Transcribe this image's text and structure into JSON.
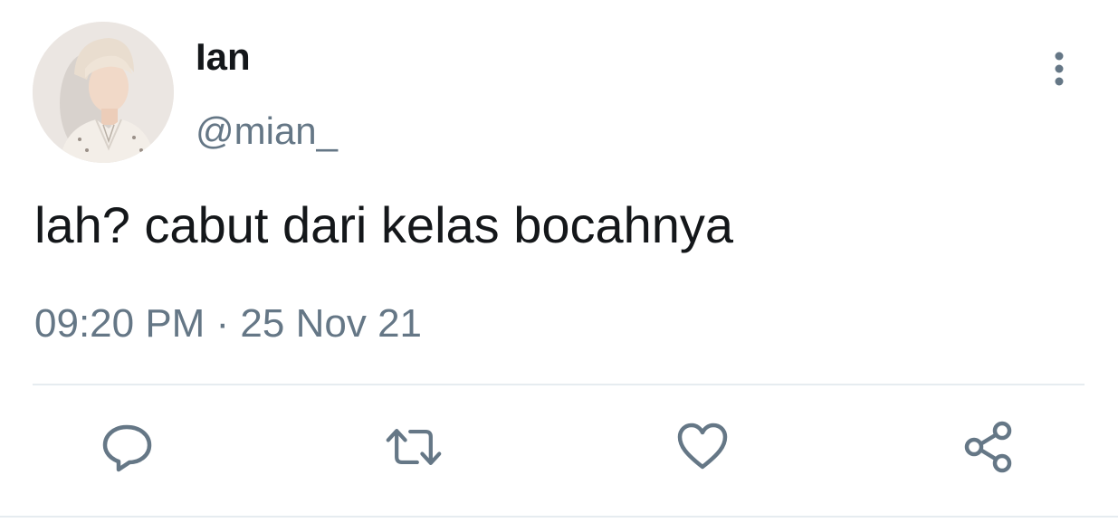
{
  "tweet": {
    "display_name": "Ian",
    "handle": "@mian_",
    "text": "lah? cabut dari kelas bocahnya",
    "timestamp": "09:20 PM · 25 Nov 21"
  },
  "icons": {
    "more": "more-vertical-icon",
    "reply": "reply-icon",
    "retweet": "retweet-icon",
    "like": "heart-icon",
    "share": "share-icon"
  },
  "colors": {
    "primary_text": "#14171a",
    "secondary_text": "#657786",
    "divider": "#e6ecf0"
  }
}
